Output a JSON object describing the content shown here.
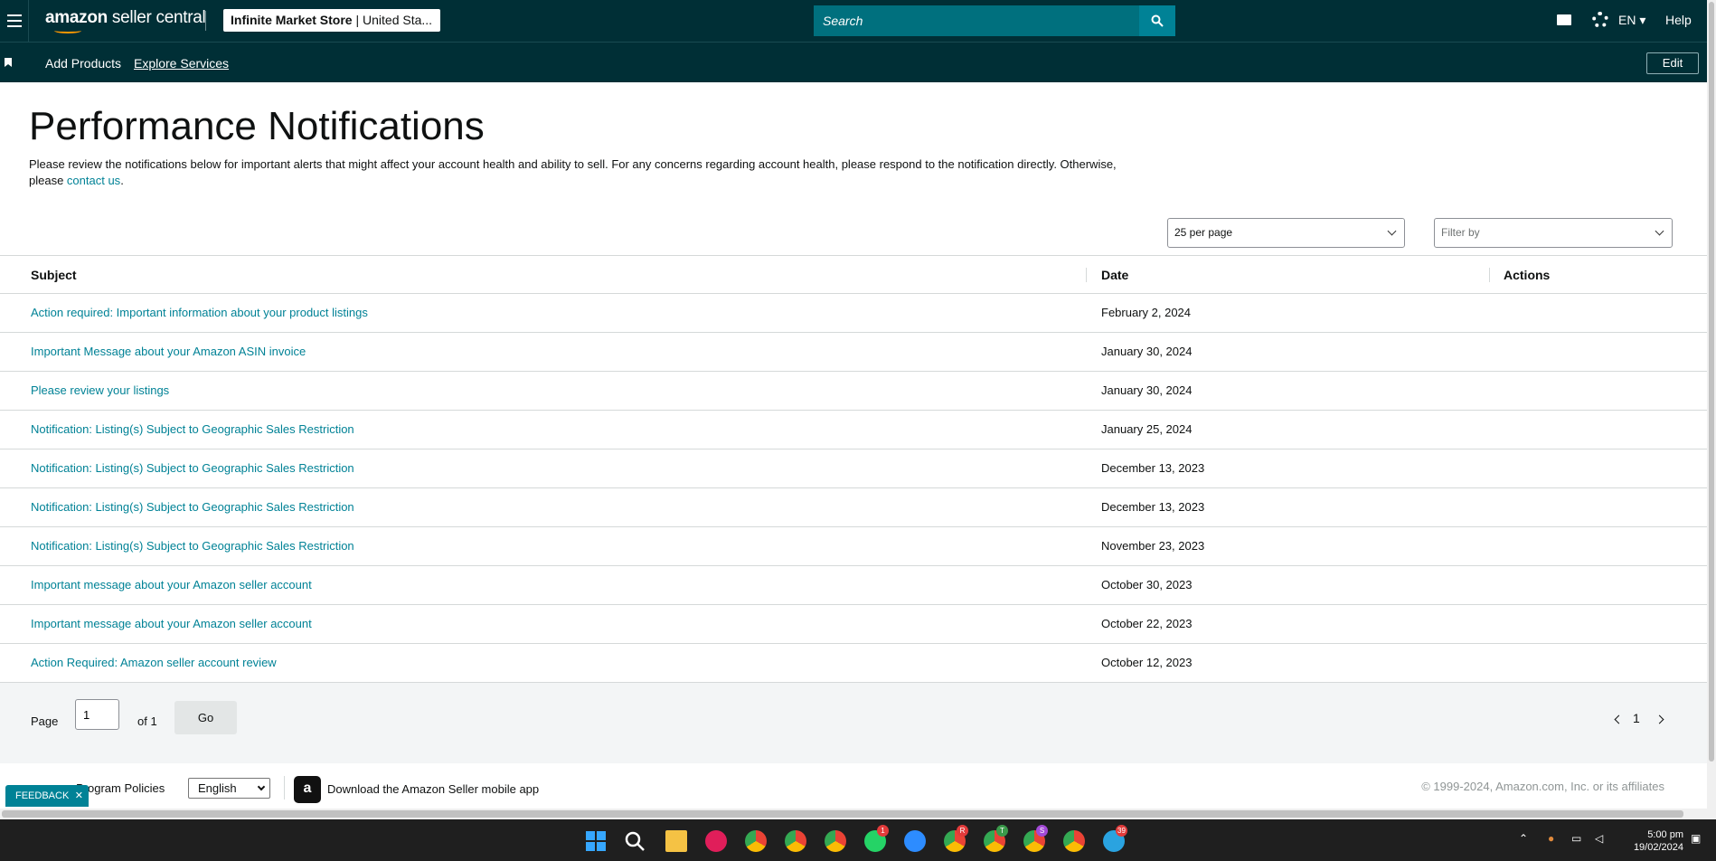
{
  "header": {
    "logo_text_bold": "amazon",
    "logo_text_rest": " seller central",
    "store_name": "Infinite Market Store",
    "store_region": " | United Sta...",
    "search_placeholder": "Search",
    "language": "EN",
    "help": "Help"
  },
  "subnav": {
    "add_products": "Add Products",
    "explore_services": "Explore Services",
    "edit": "Edit"
  },
  "main": {
    "title": "Performance Notifications",
    "description": "Please review the notifications below for important alerts that might affect your account health and ability to sell. For any concerns regarding account health, please respond to the notification directly. Otherwise, please ",
    "contact_link": "contact us",
    "description_end": ".",
    "per_page": "25 per page",
    "filter_placeholder": "Filter by"
  },
  "table": {
    "headers": [
      "Subject",
      "Date",
      "Actions"
    ],
    "rows": [
      {
        "subject": "Action required: Important information about your product listings",
        "date": "February 2, 2024"
      },
      {
        "subject": "Important Message about your Amazon ASIN invoice",
        "date": "January 30, 2024"
      },
      {
        "subject": "Please review your listings",
        "date": "January 30, 2024"
      },
      {
        "subject": "Notification: Listing(s) Subject to Geographic Sales Restriction",
        "date": "January 25, 2024"
      },
      {
        "subject": "Notification: Listing(s) Subject to Geographic Sales Restriction",
        "date": "December 13, 2023"
      },
      {
        "subject": "Notification: Listing(s) Subject to Geographic Sales Restriction",
        "date": "December 13, 2023"
      },
      {
        "subject": "Notification: Listing(s) Subject to Geographic Sales Restriction",
        "date": "November 23, 2023"
      },
      {
        "subject": "Important message about your Amazon seller account",
        "date": "October 30, 2023"
      },
      {
        "subject": "Important message about your Amazon seller account",
        "date": "October 22, 2023"
      },
      {
        "subject": "Action Required: Amazon seller account review",
        "date": "October 12, 2023"
      }
    ]
  },
  "pager": {
    "page_label": "Page",
    "page_value": "1",
    "of_label": "of 1",
    "go": "Go",
    "current": "1"
  },
  "footer": {
    "program_policies": "Program Policies",
    "language": "English",
    "app_icon_letter": "a",
    "app_text": "Download the Amazon Seller mobile app",
    "copyright": "© 1999-2024, Amazon.com, Inc. or its affiliates",
    "feedback": "FEEDBACK",
    "feedback_close": "✕"
  },
  "taskbar": {
    "badges": [
      "1",
      "R",
      "T",
      "S",
      "39"
    ],
    "time": "5:00 pm",
    "date": "19/02/2024"
  },
  "colors": {
    "header_bg": "#002f36",
    "link": "#008296",
    "search_bg": "#00707e"
  }
}
